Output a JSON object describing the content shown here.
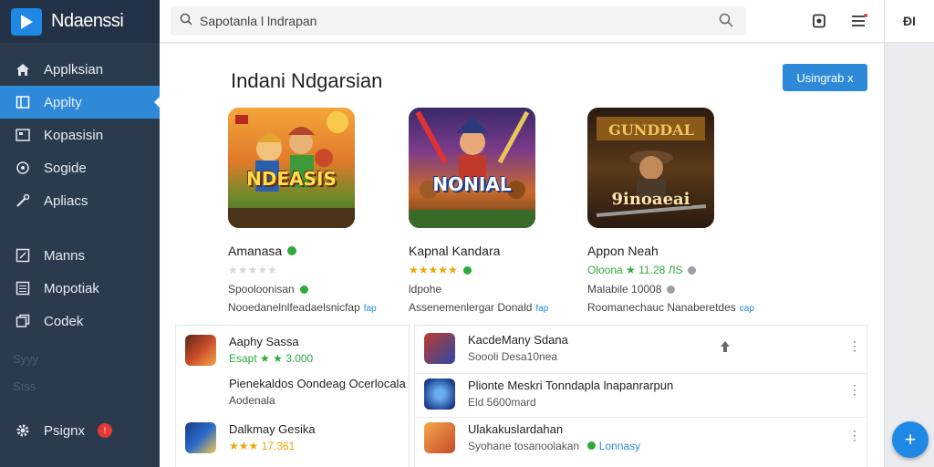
{
  "app": {
    "title": "Ndaenssi"
  },
  "sidebar": {
    "items": [
      {
        "label": "Applksian",
        "icon": "home-icon"
      },
      {
        "label": "Applty",
        "icon": "book-icon",
        "active": true
      },
      {
        "label": "Kopasisin",
        "icon": "screen-icon"
      },
      {
        "label": "Sogide",
        "icon": "circle-icon"
      },
      {
        "label": "Apliacs",
        "icon": "wrench-icon"
      },
      {
        "label": "Manns",
        "icon": "edit-icon"
      },
      {
        "label": "Mopotiak",
        "icon": "list-icon"
      },
      {
        "label": "Codek",
        "icon": "copy-icon"
      }
    ],
    "faded": [
      "Syyy",
      "Sıss"
    ],
    "footer": {
      "label": "Psignx",
      "icon": "gear-icon",
      "badge": "!"
    }
  },
  "search": {
    "value": "Sapotanla l lndrapan"
  },
  "topbar_rail_label": "ƉI",
  "main": {
    "title": "Indani Ndgarsian",
    "primary_button": "Usingrab x",
    "cards": [
      {
        "name": "Amanasa",
        "rating_stars": "★★★★★",
        "subtitle": "Spooloonisan",
        "desc": "Nooedanelnlfeadaelsnicfap",
        "tag": "fap",
        "thumb_text": "NDEASIS"
      },
      {
        "name": "Kapnal Kandara",
        "rating_stars": "★★★★★",
        "subtitle": "ldpohe",
        "desc": "Assenemenlergar Donald",
        "tag": "fap",
        "thumb_text": "NONIAL"
      },
      {
        "name": "Appon Neah",
        "rating_text": "Oloona ★ 11.28 ЛS",
        "subtitle": "Malabile 10008",
        "desc": "Roomanechauc Nanaberetdes",
        "tag": "cap",
        "thumb_text": "9inoaeai"
      }
    ],
    "left_list": [
      {
        "title": "Aaphy Sassa",
        "line2": "Esapt ★ ★ 3.000",
        "line3": ""
      },
      {
        "title": "Pienekaldos Oondeag Ocerlocala",
        "line2": "Aodenala",
        "line3": ""
      },
      {
        "title": "Dalkmay Gesika",
        "line2": "★★★ 17.361",
        "line3": ""
      }
    ],
    "right_list": [
      {
        "title": "KacdeMany Sdana",
        "line2": "Soooli Desa10nea"
      },
      {
        "title": "Plionte Meskri Tonndapla lnapanrarpun",
        "line2": "Eld 5600mard"
      },
      {
        "title": "Ulakakuslardahan",
        "line2": "Syohane tosanoolakan",
        "tag": "Lonnasy"
      }
    ]
  },
  "colors": {
    "accent": "#2e8ad8",
    "sidebar": "#2b3a4d",
    "star": "#f0a500",
    "verified": "#2eaa3c"
  }
}
